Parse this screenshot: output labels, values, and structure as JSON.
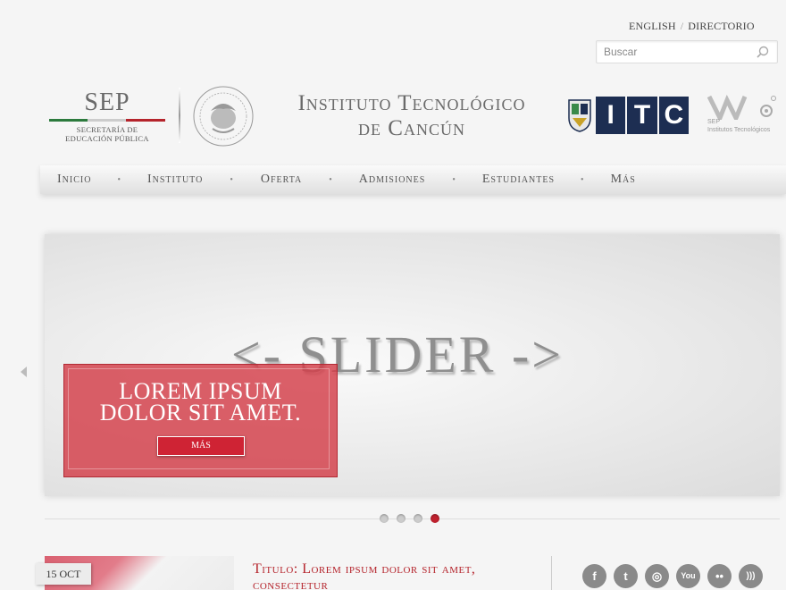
{
  "top_links": {
    "english": "ENGLISH",
    "separator": "/",
    "directorio": "DIRECTORIO"
  },
  "search": {
    "placeholder": "Buscar"
  },
  "header": {
    "sep_big": "SEP",
    "sep_small_1": "SECRETARÍA DE",
    "sep_small_2": "EDUCACIÓN PÚBLICA",
    "title_line1": "Instituto Tecnológico",
    "title_line2": "de Cancún",
    "itc_letters": [
      "I",
      "T",
      "C"
    ],
    "sep_it_label_1": "SEP",
    "sep_it_label_2": "Institutos Tecnológicos"
  },
  "nav": {
    "items": [
      {
        "label": "Inicio"
      },
      {
        "label": "Instituto"
      },
      {
        "label": "Oferta"
      },
      {
        "label": "Admisiones"
      },
      {
        "label": "Estudiantes"
      },
      {
        "label": "Más"
      }
    ],
    "separator": "•"
  },
  "slider": {
    "placeholder_text": "<- SLIDER ->",
    "caption_line1": "LOREM IPSUM",
    "caption_line2": "DOLOR SIT AMET.",
    "button_label": "MÁS",
    "dots": 4,
    "active_dot": 4
  },
  "news": {
    "date": "15 OCT",
    "title": "Titulo: Lorem ipsum dolor sit amet, consectetur"
  },
  "social": {
    "icons": [
      "facebook-icon",
      "twitter-icon",
      "instagram-icon",
      "youtube-icon",
      "flickr-icon",
      "rss-icon"
    ],
    "glyphs": [
      "f",
      "t",
      "◎",
      "You",
      "••",
      ")))"
    ]
  },
  "colors": {
    "accent": "#b5242c",
    "itc_blue": "#1d2e52",
    "caption_red": "#d33d48"
  }
}
